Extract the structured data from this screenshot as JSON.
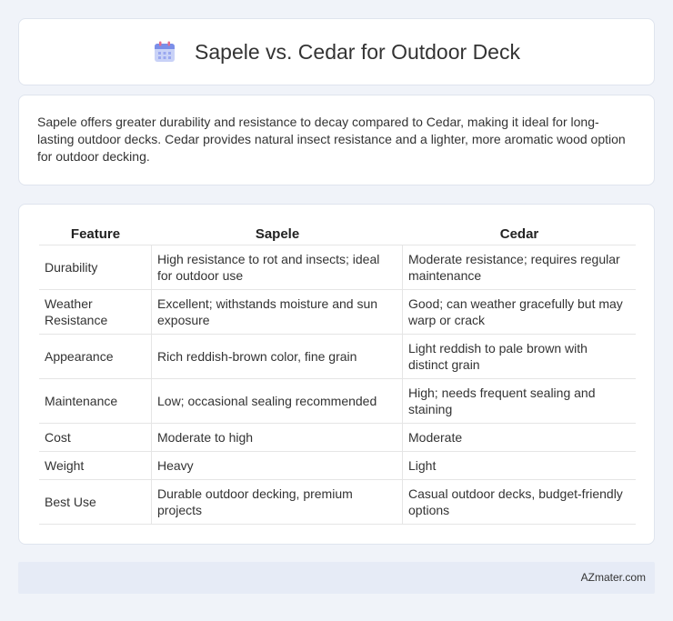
{
  "header": {
    "title": "Sapele vs. Cedar for Outdoor Deck",
    "icon": "calendar-icon",
    "accent": "#7b8ee8"
  },
  "summary": {
    "text": "Sapele offers greater durability and resistance to decay compared to Cedar, making it ideal for long-lasting outdoor decks. Cedar provides natural insect resistance and a lighter, more aromatic wood option for outdoor decking."
  },
  "table": {
    "columns": [
      "Feature",
      "Sapele",
      "Cedar"
    ],
    "rows": [
      [
        "Durability",
        "High resistance to rot and insects; ideal for outdoor use",
        "Moderate resistance; requires regular maintenance"
      ],
      [
        "Weather Resistance",
        "Excellent; withstands moisture and sun exposure",
        "Good; can weather gracefully but may warp or crack"
      ],
      [
        "Appearance",
        "Rich reddish-brown color, fine grain",
        "Light reddish to pale brown with distinct grain"
      ],
      [
        "Maintenance",
        "Low; occasional sealing recommended",
        "High; needs frequent sealing and staining"
      ],
      [
        "Cost",
        "Moderate to high",
        "Moderate"
      ],
      [
        "Weight",
        "Heavy",
        "Light"
      ],
      [
        "Best Use",
        "Durable outdoor decking, premium projects",
        "Casual outdoor decks, budget-friendly options"
      ]
    ]
  },
  "footer": {
    "text": "AZmater.com"
  }
}
